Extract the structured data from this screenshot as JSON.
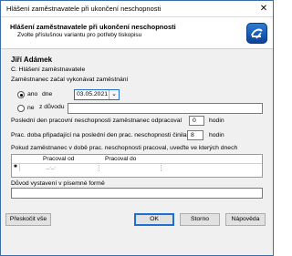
{
  "window": {
    "title": "Hlášení zaměstnavatele při ukončení neschopnosti",
    "close_glyph": "✕"
  },
  "header": {
    "title": "Hlášení zaměstnavatele při ukončení neschopnosti",
    "subtitle": "Zvolte příslušnou variantu pro potřeby tiskopisu"
  },
  "form": {
    "person_name": "Jiří Adámek",
    "section_label": "C. Hlášení zaměstnavatele",
    "started_label": "Zaměstnanec začal vykonávat zaměstnání",
    "option_yes": "ano",
    "option_yes_selected": true,
    "day_label": "dne",
    "date_value": "03.05.2021",
    "option_no": "ne",
    "reason_label": "z důvodu",
    "reason_value": "",
    "last_day_label": "Poslední den pracovní neschopnosti zaměstnanec odpracoval",
    "last_day_value": "0",
    "hours_label_1": "hodin",
    "work_time_label": "Prac. doba připadající na poslední den prac. neschopnosti činila",
    "work_time_value": "8",
    "hours_label_2": "hodin",
    "worked_during_label": "Pokud zaměstnanec v době prac. neschopnosti pracoval, uveďte ve kterých dnech",
    "grid": {
      "columns": [
        "Pracoval od",
        "Pracoval do"
      ],
      "row_marker": "✱",
      "row_placeholder": "_._."
    },
    "written_reason_label": "Důvod vystavení v písemné formě",
    "written_reason_value": ""
  },
  "footer": {
    "skip_all": "Přeskočit vše",
    "ok": "OK",
    "cancel": "Storno",
    "help": "Nápověda"
  }
}
